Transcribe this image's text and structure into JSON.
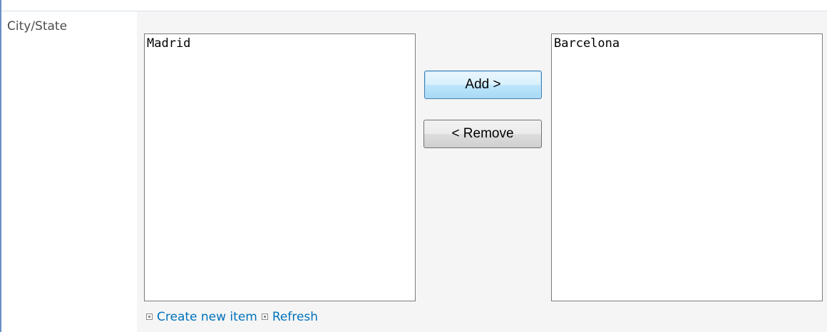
{
  "field": {
    "label": "City/State"
  },
  "available": {
    "options": [
      "Madrid"
    ]
  },
  "selected": {
    "options": [
      "Barcelona"
    ]
  },
  "buttons": {
    "add_label": "Add >",
    "remove_label": "< Remove"
  },
  "actions": {
    "create_new_item_label": "Create new item",
    "refresh_label": "Refresh",
    "bullet_icon": "small-square-bullet-icon"
  },
  "colors": {
    "link": "#0072bc",
    "panel_background": "#f5f5f5",
    "left_rule": "#6a8fc3",
    "focused_button_border": "#3c7fb1"
  }
}
